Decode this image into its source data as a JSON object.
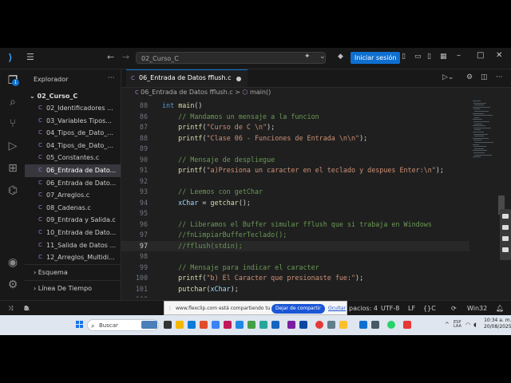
{
  "titlebar": {
    "search_text": "02_Curso_C",
    "login_label": "Iniciar sesión"
  },
  "activity": {
    "explorer_badge": "1"
  },
  "sidebar": {
    "title": "Explorador",
    "folder": "02_Curso_C",
    "files": [
      "02_Identificadores ...",
      "03_Variables Tipos...",
      "04_Tipos_de_Dato_...",
      "04_Tipos_de_Dato_...",
      "05_Constantes.c",
      "06_Entrada de Dato...",
      "06_Entrada de Dato...",
      "07_Arreglos.c",
      "08_Cadenas.c",
      "09_Entrada y Salida.c",
      "10_Entrada de Dato...",
      "11_Salida de Datos ...",
      "12_Arreglos_Multidi..."
    ],
    "outline": "Esquema",
    "timeline": "Línea De Tiempo"
  },
  "editor": {
    "tab_label": "06_Entrada de Datos fflush.c",
    "breadcrumb_file": "06_Entrada de Datos fflush.c",
    "breadcrumb_sep": ">",
    "breadcrumb_symbol": "main()",
    "sticky": {
      "ln": "80",
      "code": "int main()"
    },
    "lines": [
      {
        "ln": "86",
        "code": "    // Mandamos un mensaje a la funcion"
      },
      {
        "ln": "87",
        "code": "    printf(\"Curso de C \\n\");"
      },
      {
        "ln": "88",
        "code": "    printf(\"Clase 06 - Funciones de Entrada \\n\\n\");"
      },
      {
        "ln": "89",
        "code": ""
      },
      {
        "ln": "90",
        "code": "    // Mensaje de despliegue"
      },
      {
        "ln": "91",
        "code": "    printf(\"a)Presiona un caracter en el teclado y despues Enter:\\n\");"
      },
      {
        "ln": "92",
        "code": ""
      },
      {
        "ln": "93",
        "code": "    // Leemos con getChar"
      },
      {
        "ln": "94",
        "code": "    xChar = getchar();"
      },
      {
        "ln": "95",
        "code": ""
      },
      {
        "ln": "96",
        "code": "    // Liberamos el Buffer simular fflush que si trabaja en Windows"
      },
      {
        "ln": "97",
        "code": "    //fnLimpiarBufferTeclado();"
      },
      {
        "ln": "97",
        "code": "    //fflush(stdin);"
      },
      {
        "ln": "98",
        "code": ""
      },
      {
        "ln": "99",
        "code": "    // Mensaje para indicar el caracter"
      },
      {
        "ln": "100",
        "code": "    printf(\"b) El Caracter que presionaste fue:\");"
      },
      {
        "ln": "101",
        "code": "    putchar(xChar);"
      },
      {
        "ln": "102",
        "code": ""
      }
    ]
  },
  "statusbar": {
    "errors": "0",
    "warnings": "0",
    "spaces": "pacios: 4",
    "encoding": "UTF-8",
    "eol": "LF",
    "language": "C",
    "platform": "Win32"
  },
  "share": {
    "text": "www.flexclip.com está compartiendo tu pantalla.",
    "stop_label": "Dejar de compartir",
    "hide_label": "Ocultar"
  },
  "taskbar": {
    "search_placeholder": "Buscar",
    "lang": "ESP",
    "lang2": "LAA",
    "time": "10:34 a. m.",
    "date": "20/08/2025"
  },
  "colors": {
    "accent": "#0e6fd1",
    "keyword": "#569cd6",
    "function": "#dcdcaa",
    "string": "#ce9178",
    "comment": "#6a9955"
  }
}
